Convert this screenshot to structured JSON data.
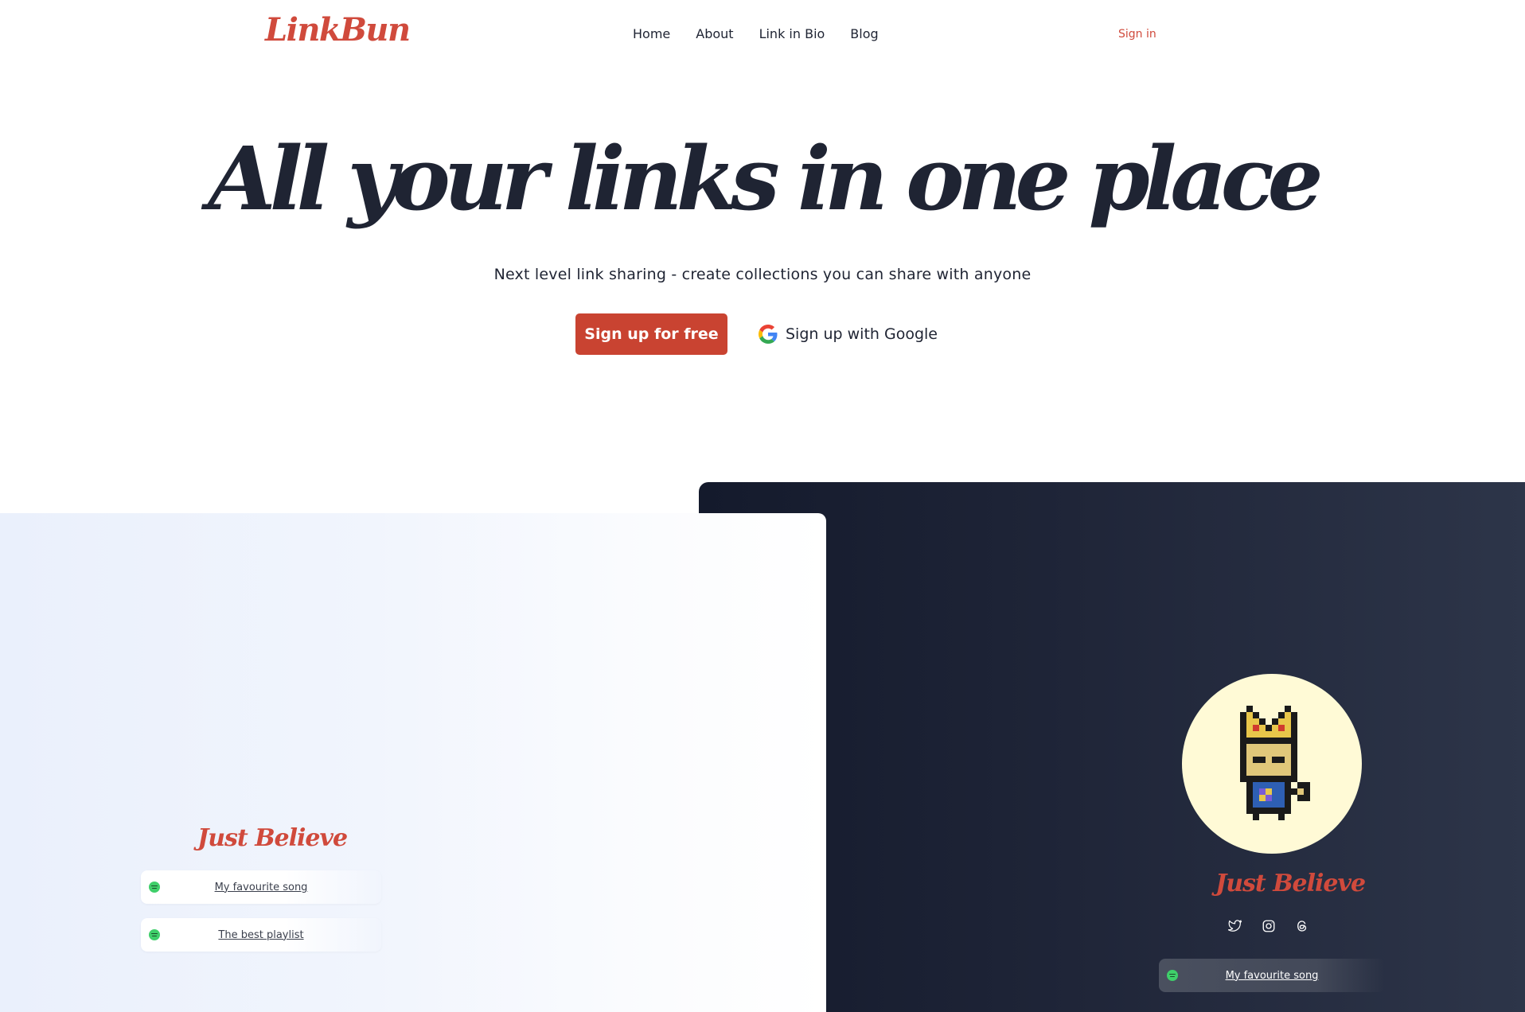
{
  "brand": {
    "logo": "LinkBun",
    "accent": "#d04a3c"
  },
  "nav": {
    "links": [
      "Home",
      "About",
      "Link in Bio",
      "Blog"
    ],
    "sign_in": "Sign in"
  },
  "hero": {
    "title": "All your links in one place",
    "subtitle": "Next level link sharing - create collections you can share with anyone",
    "primary_cta": "Sign up for free",
    "google_cta": "Sign up with Google",
    "primary_color": "#c94331"
  },
  "showcase": {
    "light_card": {
      "title": "Just Believe",
      "links": [
        {
          "label": "My favourite song",
          "icon": "spotify-icon"
        },
        {
          "label": "The best playlist",
          "icon": "spotify-icon"
        }
      ]
    },
    "dark_card": {
      "title": "Just Believe",
      "avatar": "pixel-crowned-bunny-avatar",
      "social_icons": [
        "twitter-icon",
        "instagram-icon",
        "threads-icon"
      ],
      "links": [
        {
          "label": "My favourite song",
          "icon": "spotify-icon"
        }
      ]
    }
  }
}
